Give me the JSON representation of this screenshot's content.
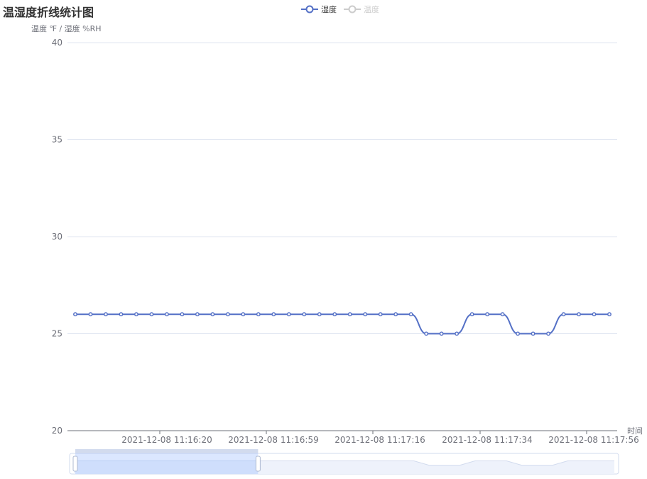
{
  "chart_data": {
    "type": "line",
    "title": "温湿度折线统计图",
    "ylabel": "温度 ℉ / 湿度 %RH",
    "xlabel": "时间",
    "ylim": [
      20,
      40
    ],
    "y_ticks": [
      20,
      25,
      30,
      35,
      40
    ],
    "x_tick_labels": [
      "2021-12-08 11:16:20",
      "2021-12-08 11:16:59",
      "2021-12-08 11:17:16",
      "2021-12-08 11:17:34",
      "2021-12-08 11:17:56"
    ],
    "grid": true,
    "legend_position": "top",
    "series": [
      {
        "name": "湿度",
        "visible": true,
        "color": "#5470c6",
        "smooth": true,
        "values": [
          26,
          26,
          26,
          26,
          26,
          26,
          26,
          26,
          26,
          26,
          26,
          26,
          26,
          26,
          26,
          26,
          26,
          26,
          26,
          26,
          26,
          26,
          26,
          25,
          25,
          25,
          26,
          26,
          26,
          25,
          25,
          25,
          26,
          26,
          26,
          26
        ]
      },
      {
        "name": "温度",
        "visible": false,
        "color": "#cccccc",
        "values": []
      }
    ],
    "data_zoom": {
      "start_fraction": 0.0,
      "end_fraction": 0.34
    }
  }
}
